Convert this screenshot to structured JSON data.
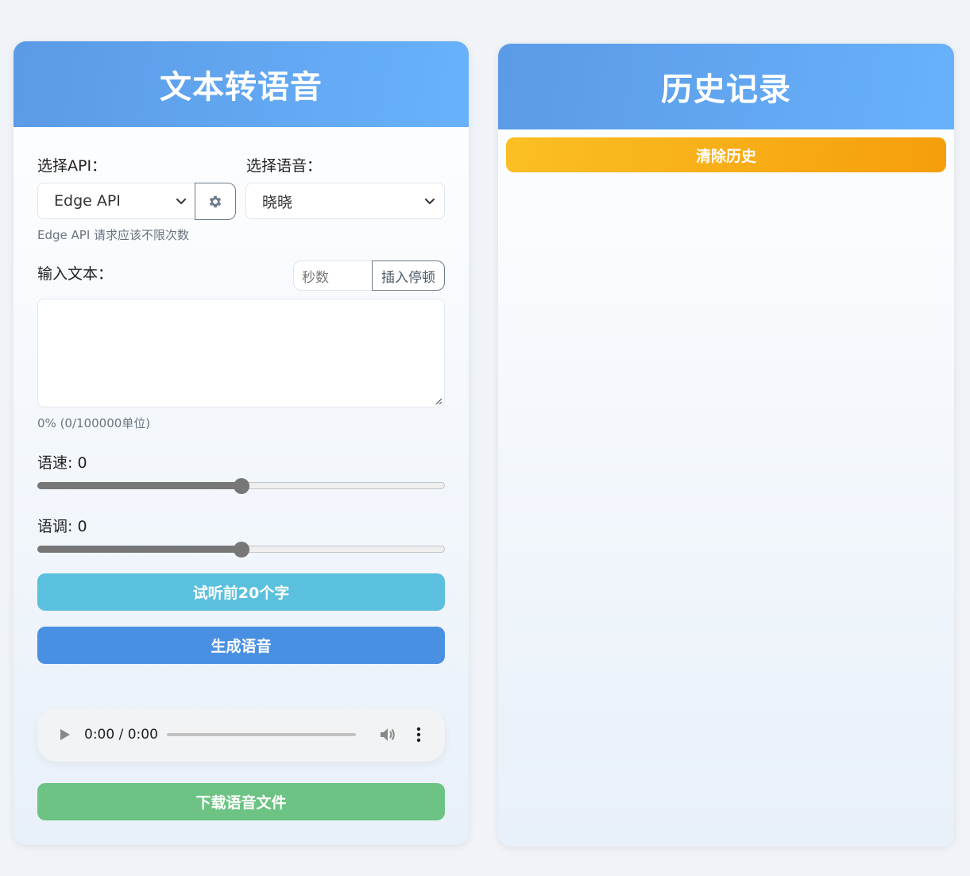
{
  "left_panel": {
    "title": "文本转语音",
    "api_label": "选择API：",
    "api_select_value": "Edge API",
    "voice_label": "选择语音：",
    "voice_select_value": "晓晓",
    "api_hint": "Edge API 请求应该不限次数",
    "text_label": "输入文本：",
    "seconds_placeholder": "秒数",
    "insert_pause_label": "插入停顿",
    "text_value": "",
    "char_count": "0% (0/100000单位)",
    "speed_label": "语速: 0",
    "speed_level": 0.5,
    "pitch_label": "语调: 0",
    "pitch_level": 0.5,
    "preview_button": "试听前20个字",
    "generate_button": "生成语音",
    "audio_time": "0:00 / 0:00",
    "download_button": "下载语音文件"
  },
  "right_panel": {
    "title": "历史记录",
    "clear_button": "清除历史"
  },
  "colors": {
    "header_start": "#5b9ae5",
    "header_end": "#68b1fb",
    "preview_button": "#5bc0de",
    "generate_button": "#4a90e2",
    "download_button": "#6cc383",
    "clear_button_start": "#fbbf24",
    "clear_button_end": "#f59e0b"
  },
  "icons": {
    "settings": "gear-icon",
    "dropdown": "chevron-down-icon",
    "play": "play-icon",
    "volume": "volume-icon",
    "more": "more-vertical-icon"
  }
}
